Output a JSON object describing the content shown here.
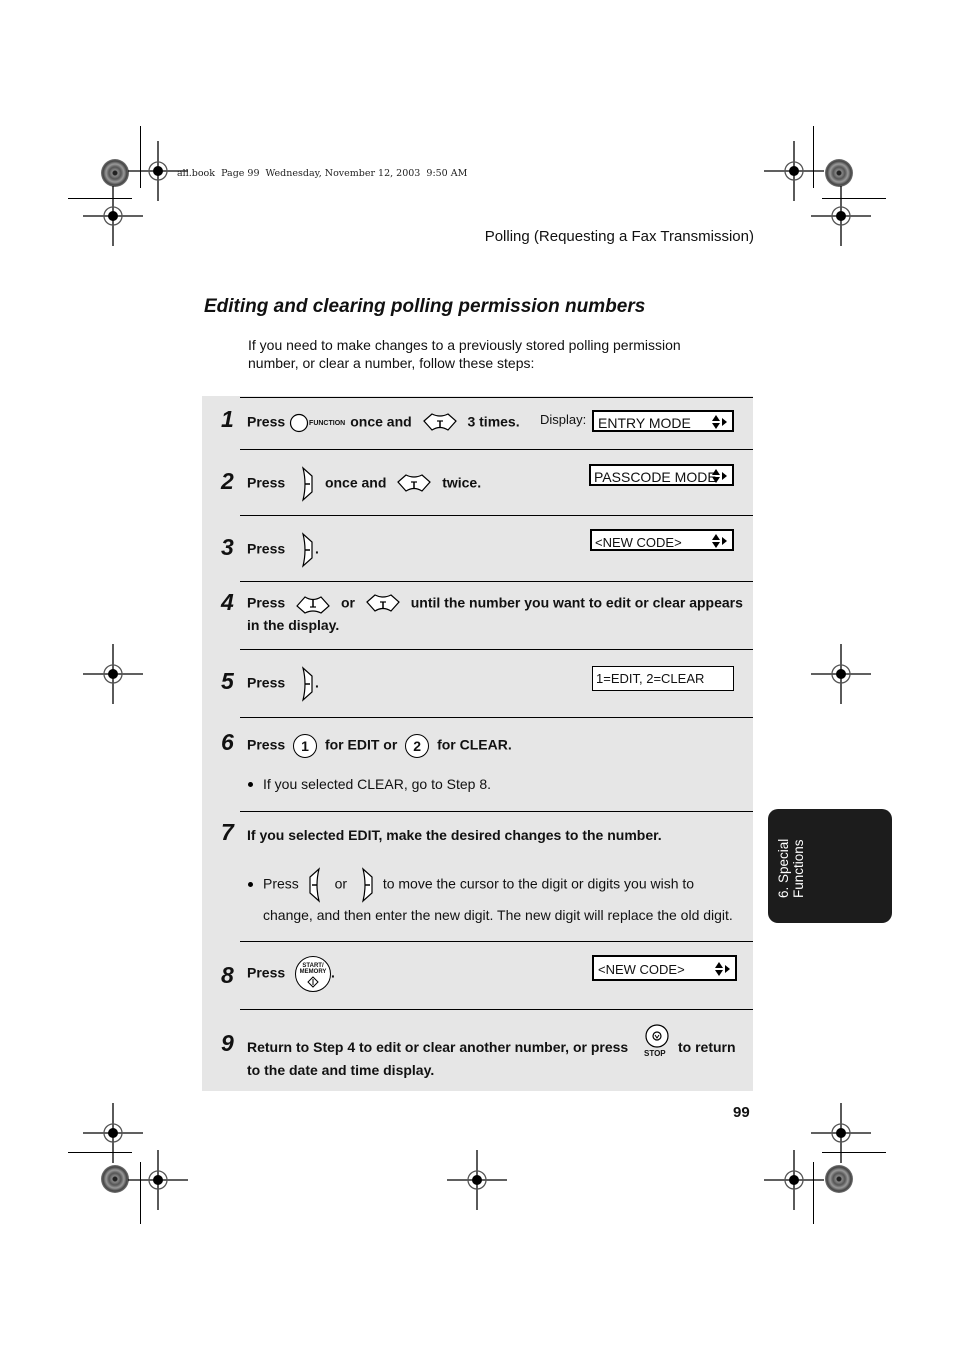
{
  "file_info": "all.book  Page 99  Wednesday, November 12, 2003  9:50 AM",
  "running_head": "Polling (Requesting a Fax Transmission)",
  "section_title": "Editing and clearing polling permission numbers",
  "intro": "If you need to make changes to a previously stored polling permission number, or clear a number, follow these steps:",
  "display_label": "Display:",
  "steps": [
    {
      "num": "1",
      "press": "Press",
      "t1": "once and",
      "t2": "3 times.",
      "key1": "function-key",
      "key1_label": "FUNCTION",
      "key2": "down-arrow-key",
      "display": "ENTRY MODE"
    },
    {
      "num": "2",
      "press": "Press",
      "t1": "once and",
      "t2": "twice.",
      "key1": "right-arrow-key",
      "key2": "down-arrow-key",
      "display": "PASSCODE MODE"
    },
    {
      "num": "3",
      "press": "Press",
      "t1": ".",
      "key1": "right-arrow-key",
      "display": "<NEW CODE>"
    },
    {
      "num": "4",
      "press": "Press",
      "t1": "or",
      "t2": "until the number you want to edit or clear appears",
      "t3": "in the display.",
      "key1": "up-arrow-key",
      "key2": "down-arrow-key"
    },
    {
      "num": "5",
      "press": "Press",
      "t1": ".",
      "key1": "right-arrow-key",
      "display": "1=EDIT, 2=CLEAR"
    },
    {
      "num": "6",
      "press": "Press",
      "key1_label": "1",
      "t1": "for EDIT or",
      "key2_label": "2",
      "t2": "for CLEAR.",
      "bullet": "If you selected CLEAR, go to Step 8."
    },
    {
      "num": "7",
      "text": "If you selected EDIT, make the desired changes to the number.",
      "bullet_press": "Press",
      "bullet_or": "or",
      "bullet_rest": "to move the cursor to the digit or digits you wish to",
      "bullet_line2": "change, and then enter the new digit. The new digit will replace the old digit."
    },
    {
      "num": "8",
      "press": "Press",
      "t1": ".",
      "key1_label_top": "START/",
      "key1_label_bottom": "MEMORY",
      "display": "<NEW CODE>"
    },
    {
      "num": "9",
      "t1": "Return to Step 4 to edit or clear another number, or press",
      "t2": "to return",
      "t3": "to the date and time display.",
      "stop_label": "STOP"
    }
  ],
  "side_tab": {
    "line1": "6. Special",
    "line2": "Functions"
  },
  "page_number": "99"
}
